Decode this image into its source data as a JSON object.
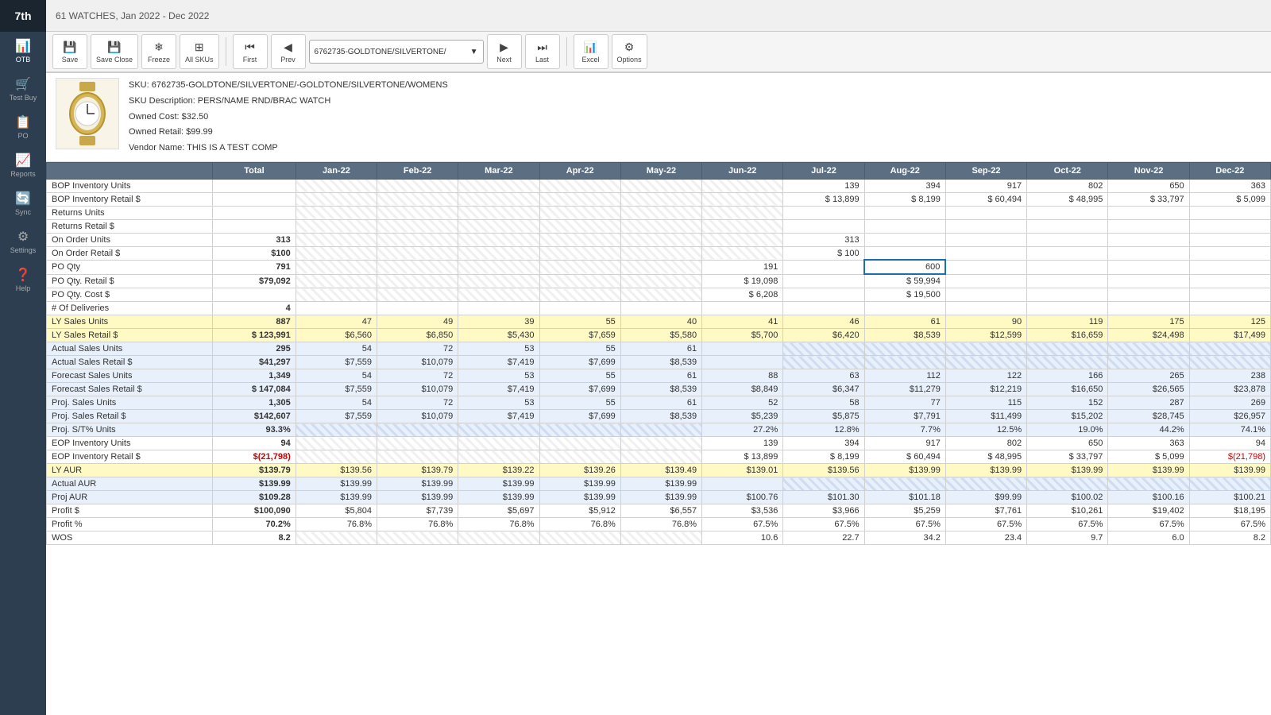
{
  "sidebar": {
    "brand": "7th",
    "items": [
      {
        "label": "OTB",
        "icon": "📊"
      },
      {
        "label": "Test Buy",
        "icon": "🛒"
      },
      {
        "label": "PO",
        "icon": "📋"
      },
      {
        "label": "Reports",
        "icon": "📈"
      },
      {
        "label": "Sync",
        "icon": "🔄"
      },
      {
        "label": "Settings",
        "icon": "⚙"
      },
      {
        "label": "Help",
        "icon": "❓"
      }
    ]
  },
  "header": {
    "title": "61 WATCHES, Jan 2022 - Dec 2022"
  },
  "toolbar": {
    "buttons": [
      {
        "label": "Save",
        "icon": "💾"
      },
      {
        "label": "Save Close",
        "icon": "💾"
      },
      {
        "label": "Freeze",
        "icon": "❄"
      },
      {
        "label": "All SKUs",
        "icon": "⊞"
      },
      {
        "label": "First",
        "icon": "⏮"
      },
      {
        "label": "Prev",
        "icon": "◀"
      },
      {
        "label": "Next",
        "icon": "▶"
      },
      {
        "label": "Last",
        "icon": "⏭"
      },
      {
        "label": "Excel",
        "icon": "📊"
      },
      {
        "label": "Options",
        "icon": "⚙"
      }
    ],
    "sku_dropdown": "6762735-GOLDTONE/SILVERTONE/"
  },
  "product": {
    "sku": "SKU: 6762735-GOLDTONE/SILVERTONE/-GOLDTONE/SILVERTONE/WOMENS",
    "description": "SKU Description: PERS/NAME RND/BRAC WATCH",
    "owned_cost": "Owned Cost: $32.50",
    "owned_retail": "Owned Retail: $99.99",
    "vendor": "Vendor Name: THIS IS A TEST COMP"
  },
  "grid": {
    "headers": [
      "",
      "Total",
      "Jan-22",
      "Feb-22",
      "Mar-22",
      "Apr-22",
      "May-22",
      "Jun-22",
      "Jul-22",
      "Aug-22",
      "Sep-22",
      "Oct-22",
      "Nov-22",
      "Dec-22"
    ],
    "rows": [
      {
        "label": "BOP Inventory Units",
        "type": "normal",
        "total": "",
        "jan": "",
        "feb": "",
        "mar": "",
        "apr": "",
        "may": "",
        "jun": "",
        "jul": "139",
        "aug": "394",
        "sep": "917",
        "oct": "802",
        "nov": "650",
        "dec": "363"
      },
      {
        "label": "BOP Inventory Retail $",
        "type": "normal",
        "total": "",
        "jan": "",
        "feb": "",
        "mar": "",
        "apr": "",
        "may": "",
        "jun": "",
        "jul": "$ 13,899",
        "aug": "$ 8,199",
        "sep": "$ 60,494",
        "oct": "$ 48,995",
        "nov": "$ 33,797",
        "dec": "$ 5,099"
      },
      {
        "label": "Returns Units",
        "type": "normal",
        "total": "",
        "jan": "",
        "feb": "",
        "mar": "",
        "apr": "",
        "may": "",
        "jun": "",
        "jul": "",
        "aug": "",
        "sep": "",
        "oct": "",
        "nov": "",
        "dec": ""
      },
      {
        "label": "Returns Retail $",
        "type": "normal",
        "total": "",
        "jan": "",
        "feb": "",
        "mar": "",
        "apr": "",
        "may": "",
        "jun": "",
        "jul": "",
        "aug": "",
        "sep": "",
        "oct": "",
        "nov": "",
        "dec": ""
      },
      {
        "label": "On Order Units",
        "type": "normal",
        "total": "313",
        "jan": "",
        "feb": "",
        "mar": "",
        "apr": "",
        "may": "",
        "jun": "",
        "jul": "313",
        "aug": "",
        "sep": "",
        "oct": "",
        "nov": "",
        "dec": ""
      },
      {
        "label": "On Order Retail $",
        "type": "normal",
        "total": "$100",
        "jan": "",
        "feb": "",
        "mar": "",
        "apr": "",
        "may": "",
        "jun": "",
        "jul": "$ 100",
        "aug": "",
        "sep": "",
        "oct": "",
        "nov": "",
        "dec": ""
      },
      {
        "label": "PO Qty",
        "type": "normal",
        "total": "791",
        "jan": "",
        "feb": "",
        "mar": "",
        "apr": "",
        "may": "",
        "jun": "191",
        "jul": "",
        "aug": "600",
        "sep": "",
        "oct": "",
        "nov": "",
        "dec": ""
      },
      {
        "label": "PO Qty. Retail $",
        "type": "normal",
        "total": "$79,092",
        "jan": "",
        "feb": "",
        "mar": "",
        "apr": "",
        "may": "",
        "jun": "$ 19,098",
        "jul": "",
        "aug": "$ 59,994",
        "sep": "",
        "oct": "",
        "nov": "",
        "dec": ""
      },
      {
        "label": "PO Qty. Cost $",
        "type": "normal",
        "total": "",
        "jan": "",
        "feb": "",
        "mar": "",
        "apr": "",
        "may": "",
        "jun": "$ 6,208",
        "jul": "",
        "aug": "$ 19,500",
        "sep": "",
        "oct": "",
        "nov": "",
        "dec": ""
      },
      {
        "label": "# Of Deliveries",
        "type": "normal",
        "total": "4",
        "jan": "",
        "feb": "",
        "mar": "",
        "apr": "",
        "may": "",
        "jun": "",
        "jul": "",
        "aug": "",
        "sep": "",
        "oct": "",
        "nov": "",
        "dec": ""
      },
      {
        "label": "LY Sales Units",
        "type": "ly",
        "total": "887",
        "jan": "47",
        "feb": "49",
        "mar": "39",
        "apr": "55",
        "may": "40",
        "jun": "41",
        "jul": "46",
        "aug": "61",
        "sep": "90",
        "oct": "119",
        "nov": "175",
        "dec": "125"
      },
      {
        "label": "LY Sales Retail $",
        "type": "ly",
        "total": "$ 123,991",
        "jan": "$6,560",
        "feb": "$6,850",
        "mar": "$5,430",
        "apr": "$7,659",
        "may": "$5,580",
        "jun": "$5,700",
        "jul": "$6,420",
        "aug": "$8,539",
        "sep": "$12,599",
        "oct": "$16,659",
        "nov": "$24,498",
        "dec": "$17,499"
      },
      {
        "label": "Actual Sales Units",
        "type": "actual",
        "total": "295",
        "jan": "54",
        "feb": "72",
        "mar": "53",
        "apr": "55",
        "may": "61",
        "jun": "",
        "jul": "",
        "aug": "",
        "sep": "",
        "oct": "",
        "nov": "",
        "dec": ""
      },
      {
        "label": "Actual Sales Retail $",
        "type": "actual",
        "total": "$41,297",
        "jan": "$7,559",
        "feb": "$10,079",
        "mar": "$7,419",
        "apr": "$7,699",
        "may": "$8,539",
        "jun": "",
        "jul": "",
        "aug": "",
        "sep": "",
        "oct": "",
        "nov": "",
        "dec": ""
      },
      {
        "label": "Forecast Sales Units",
        "type": "forecast",
        "total": "1,349",
        "jan": "54",
        "feb": "72",
        "mar": "53",
        "apr": "55",
        "may": "61",
        "jun": "88",
        "jul": "63",
        "aug": "112",
        "sep": "122",
        "oct": "166",
        "nov": "265",
        "dec": "238"
      },
      {
        "label": "Forecast Sales Retail $",
        "type": "forecast",
        "total": "$ 147,084",
        "jan": "$7,559",
        "feb": "$10,079",
        "mar": "$7,419",
        "apr": "$7,699",
        "may": "$8,539",
        "jun": "$8,849",
        "jul": "$6,347",
        "aug": "$11,279",
        "sep": "$12,219",
        "oct": "$16,650",
        "nov": "$26,565",
        "dec": "$23,878"
      },
      {
        "label": "Proj. Sales Units",
        "type": "proj",
        "total": "1,305",
        "jan": "54",
        "feb": "72",
        "mar": "53",
        "apr": "55",
        "may": "61",
        "jun": "52",
        "jul": "58",
        "aug": "77",
        "sep": "115",
        "oct": "152",
        "nov": "287",
        "dec": "269"
      },
      {
        "label": "Proj. Sales Retail $",
        "type": "proj",
        "total": "$142,607",
        "jan": "$7,559",
        "feb": "$10,079",
        "mar": "$7,419",
        "apr": "$7,699",
        "may": "$8,539",
        "jun": "$5,239",
        "jul": "$5,875",
        "aug": "$7,791",
        "sep": "$11,499",
        "oct": "$15,202",
        "nov": "$28,745",
        "dec": "$26,957"
      },
      {
        "label": "Proj. S/T% Units",
        "type": "proj",
        "total": "93.3%",
        "jan": "",
        "feb": "",
        "mar": "",
        "apr": "",
        "may": "",
        "jun": "27.2%",
        "jul": "12.8%",
        "aug": "7.7%",
        "sep": "12.5%",
        "oct": "19.0%",
        "nov": "44.2%",
        "dec": "74.1%"
      },
      {
        "label": "EOP Inventory Units",
        "type": "normal",
        "total": "94",
        "jan": "",
        "feb": "",
        "mar": "",
        "apr": "",
        "may": "",
        "jun": "139",
        "jul": "394",
        "aug": "917",
        "sep": "802",
        "oct": "650",
        "nov": "363",
        "dec": "94"
      },
      {
        "label": "EOP Inventory Retail $",
        "type": "eop",
        "total": "$(21,798)",
        "jan": "",
        "feb": "",
        "mar": "",
        "apr": "",
        "may": "",
        "jun": "$ 13,899",
        "jul": "$ 8,199",
        "aug": "$ 60,494",
        "sep": "$ 48,995",
        "oct": "$ 33,797",
        "nov": "$ 5,099",
        "dec": "$(21,798)"
      },
      {
        "label": "LY AUR",
        "type": "ly",
        "total": "$139.79",
        "jan": "$139.56",
        "feb": "$139.79",
        "mar": "$139.22",
        "apr": "$139.26",
        "may": "$139.49",
        "jun": "$139.01",
        "jul": "$139.56",
        "aug": "$139.99",
        "sep": "$139.99",
        "oct": "$139.99",
        "nov": "$139.99",
        "dec": "$139.99"
      },
      {
        "label": "Actual AUR",
        "type": "actual",
        "total": "$139.99",
        "jan": "$139.99",
        "feb": "$139.99",
        "mar": "$139.99",
        "apr": "$139.99",
        "may": "$139.99",
        "jun": "",
        "jul": "",
        "aug": "",
        "sep": "",
        "oct": "",
        "nov": "",
        "dec": ""
      },
      {
        "label": "Proj AUR",
        "type": "proj",
        "total": "$109.28",
        "jan": "$139.99",
        "feb": "$139.99",
        "mar": "$139.99",
        "apr": "$139.99",
        "may": "$139.99",
        "jun": "$100.76",
        "jul": "$101.30",
        "aug": "$101.18",
        "sep": "$99.99",
        "oct": "$100.02",
        "nov": "$100.16",
        "dec": "$100.21"
      },
      {
        "label": "Profit $",
        "type": "normal",
        "total": "$100,090",
        "jan": "$5,804",
        "feb": "$7,739",
        "mar": "$5,697",
        "apr": "$5,912",
        "may": "$6,557",
        "jun": "$3,536",
        "jul": "$3,966",
        "aug": "$5,259",
        "sep": "$7,761",
        "oct": "$10,261",
        "nov": "$19,402",
        "dec": "$18,195"
      },
      {
        "label": "Profit %",
        "type": "normal",
        "total": "70.2%",
        "jan": "76.8%",
        "feb": "76.8%",
        "mar": "76.8%",
        "apr": "76.8%",
        "may": "76.8%",
        "jun": "67.5%",
        "jul": "67.5%",
        "aug": "67.5%",
        "sep": "67.5%",
        "oct": "67.5%",
        "nov": "67.5%",
        "dec": "67.5%"
      },
      {
        "label": "WOS",
        "type": "normal",
        "total": "8.2",
        "jan": "",
        "feb": "",
        "mar": "",
        "apr": "",
        "may": "",
        "jun": "10.6",
        "jul": "22.7",
        "aug": "34.2",
        "sep": "23.4",
        "oct": "9.7",
        "nov": "6.0",
        "dec": "8.2"
      }
    ]
  }
}
